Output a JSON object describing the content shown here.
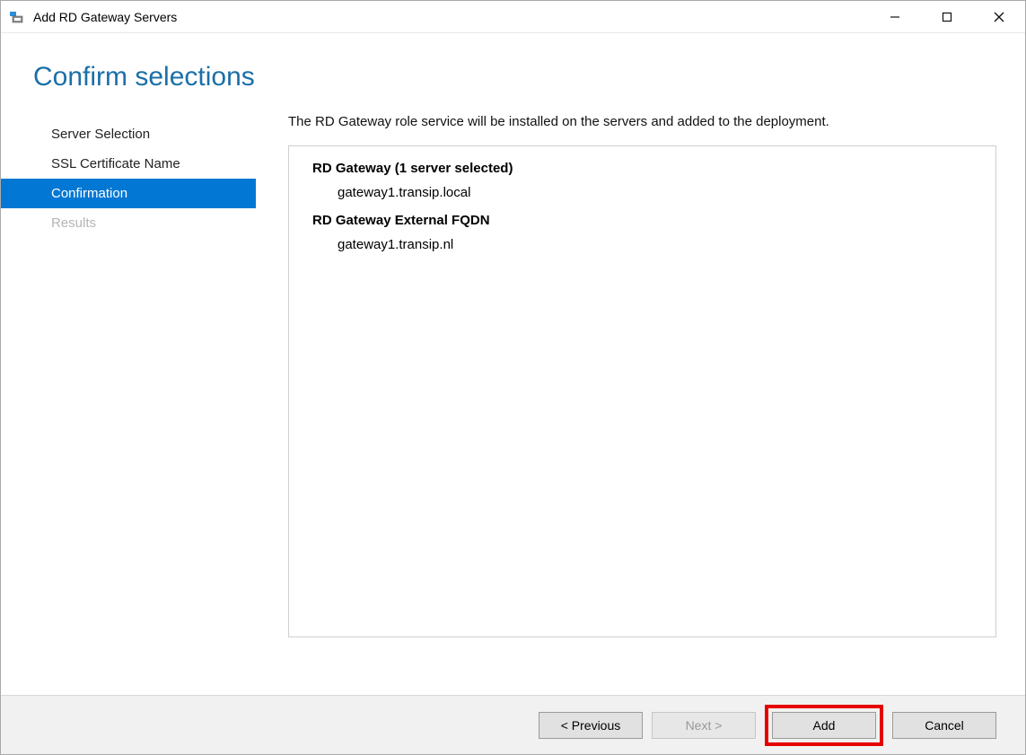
{
  "window": {
    "title": "Add RD Gateway Servers"
  },
  "page": {
    "title": "Confirm selections"
  },
  "nav": {
    "items": [
      {
        "label": "Server Selection",
        "state": "normal"
      },
      {
        "label": "SSL Certificate Name",
        "state": "normal"
      },
      {
        "label": "Confirmation",
        "state": "selected"
      },
      {
        "label": "Results",
        "state": "disabled"
      }
    ]
  },
  "main": {
    "info": "The RD Gateway role service will be installed on the servers and added to the deployment.",
    "groups": [
      {
        "title": "RD Gateway  (1 server selected)",
        "items": [
          "gateway1.transip.local"
        ]
      },
      {
        "title": "RD Gateway External FQDN",
        "items": [
          "gateway1.transip.nl"
        ]
      }
    ]
  },
  "footer": {
    "previous": "< Previous",
    "next": "Next >",
    "add": "Add",
    "cancel": "Cancel"
  }
}
